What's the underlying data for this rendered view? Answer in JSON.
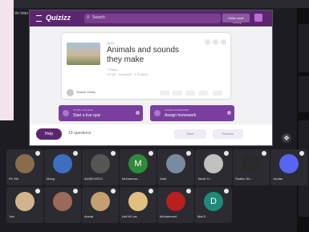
{
  "window": {
    "title": "Vo Inter Chivalan"
  },
  "quizizz": {
    "logo": "Quizizz",
    "search_placeholder": "Search",
    "library_label": "Quizizz library",
    "enter_code_label": "Enter code"
  },
  "quiz_card": {
    "type_label": "QUIZ",
    "title": "Animals and sounds they make",
    "meta1": "7 Plays",
    "meta2": "19 Qs · 1st grade · 1 Subject",
    "author": "Shawn Darby"
  },
  "actions": {
    "live_sub": "START LIVE QUIZ",
    "live_label": "Start a live quiz",
    "hw_sub": "ASSIGN HOMEWORK",
    "hw_label": "Assign homework"
  },
  "bottom": {
    "help_label": "Help",
    "questions_label": "19 questions",
    "save_label": "Save",
    "preview_label": "Preview"
  },
  "participants": [
    {
      "name": "Pe Sth",
      "color": "#8a6b4a",
      "letter": ""
    },
    {
      "name": "Mang",
      "color": "#3e6fbf",
      "letter": ""
    },
    {
      "name": "&#465;VEC1",
      "color": "#555",
      "letter": ""
    },
    {
      "name": "Muhamma...",
      "color": "#2f8a3a",
      "letter": "M"
    },
    {
      "name": "Said",
      "color": "#7a8aa0",
      "letter": ""
    },
    {
      "name": "Tanvir H...",
      "color": "#c0c0c0",
      "letter": ""
    },
    {
      "name": "Shahin Sh...",
      "color": "#2a2a2a",
      "letter": ""
    },
    {
      "name": "Jordan",
      "color": "#5865f2",
      "letter": ""
    },
    {
      "name": "Yan",
      "color": "#d2b48c",
      "letter": ""
    },
    {
      "name": "",
      "color": "#9a6a5a",
      "letter": ""
    },
    {
      "name": "Anwar",
      "color": "#c4a070",
      "letter": ""
    },
    {
      "name": "Asif M Las",
      "color": "#e0c080",
      "letter": ""
    },
    {
      "name": "Mohammed",
      "color": "#b81f1f",
      "letter": ""
    },
    {
      "name": "Mai D",
      "color": "#1f8a7a",
      "letter": "D"
    }
  ]
}
